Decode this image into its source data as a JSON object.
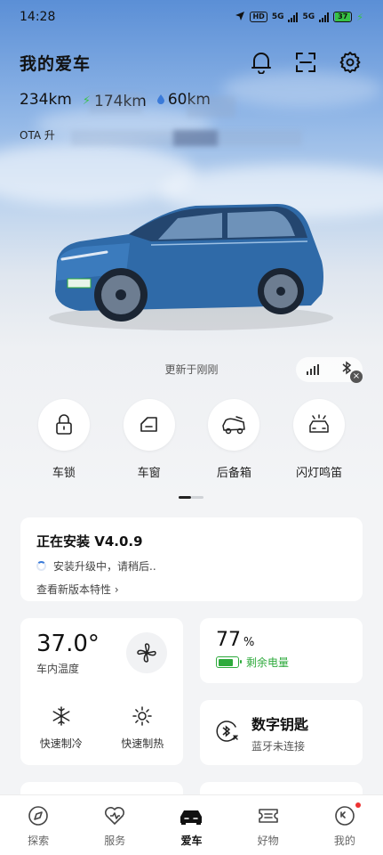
{
  "status_bar": {
    "time": "14:28",
    "hd_badge": "HD",
    "network_1": "5G",
    "network_2": "5G",
    "battery_percent": "37"
  },
  "header": {
    "title": "我的爱车",
    "icons": [
      "bell-icon",
      "scan-icon",
      "settings-icon"
    ]
  },
  "range": {
    "total": "234km",
    "electric": "174km",
    "fuel": "60km"
  },
  "ota_line": "OTA 升",
  "updated_text": "更新于刚刚",
  "controls": [
    {
      "label": "车锁",
      "icon": "lock-icon"
    },
    {
      "label": "车窗",
      "icon": "window-icon"
    },
    {
      "label": "后备箱",
      "icon": "trunk-icon"
    },
    {
      "label": "闪灯鸣笛",
      "icon": "flash-horn-icon"
    }
  ],
  "ota_card": {
    "title": "正在安装 V4.0.9",
    "status": "安装升级中，请稍后..",
    "link": "查看新版本特性 ›"
  },
  "climate": {
    "temperature": "37.0°",
    "label": "车内温度",
    "cool_label": "快速制冷",
    "heat_label": "快速制热"
  },
  "battery_card": {
    "percent": "77",
    "unit": "%",
    "label": "剩余电量"
  },
  "digital_key": {
    "title": "数字钥匙",
    "subtitle": "蓝牙未连接"
  },
  "tabs": [
    {
      "label": "探索",
      "icon": "explore-icon"
    },
    {
      "label": "服务",
      "icon": "service-icon"
    },
    {
      "label": "爱车",
      "icon": "car-icon"
    },
    {
      "label": "好物",
      "icon": "shop-icon"
    },
    {
      "label": "我的",
      "icon": "profile-icon"
    }
  ],
  "colors": {
    "accent_green": "#2eaa3c",
    "car_blue": "#2f6aa8",
    "sky_blue": "#5b8fd6"
  }
}
